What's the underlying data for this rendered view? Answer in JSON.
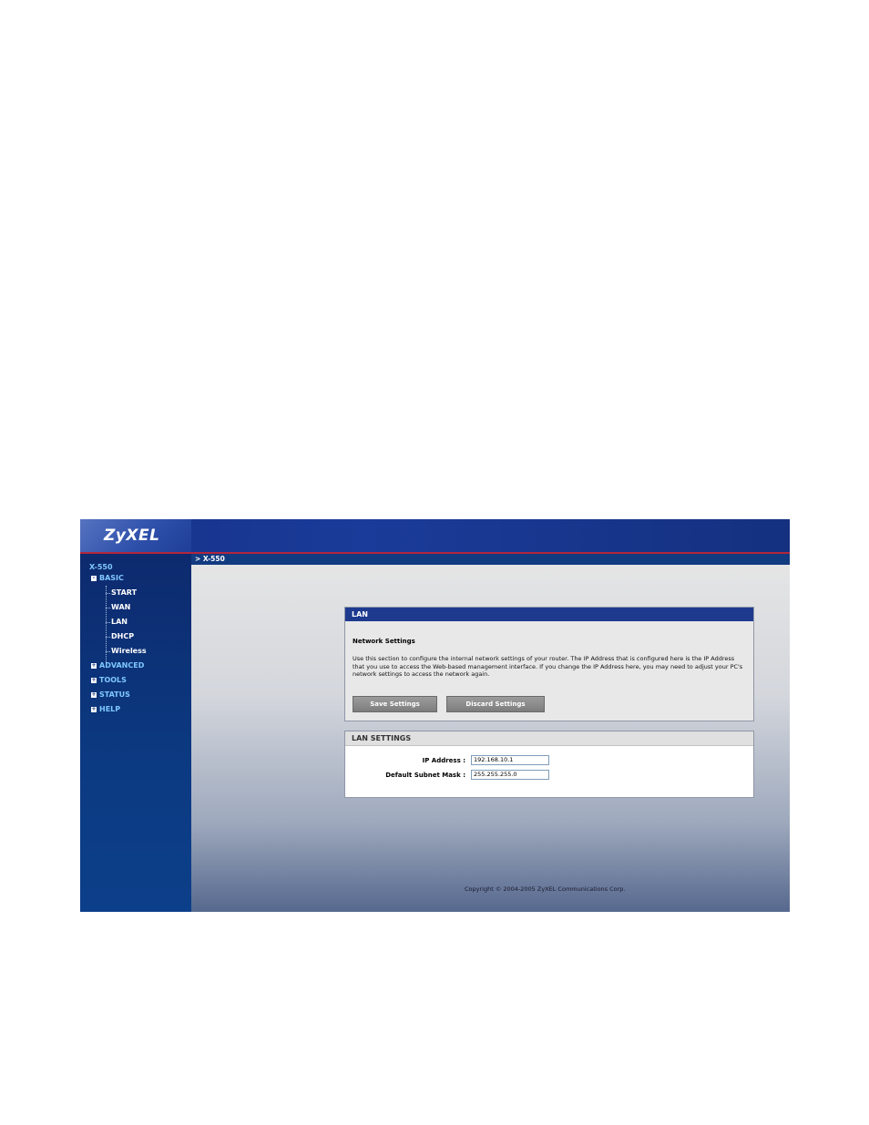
{
  "header": {
    "logo": "ZyXEL"
  },
  "sidebar": {
    "device": "X-550",
    "menu": [
      {
        "label": "BASIC",
        "children": [
          "START",
          "WAN",
          "LAN",
          "DHCP",
          "Wireless"
        ]
      },
      {
        "label": "ADVANCED"
      },
      {
        "label": "TOOLS"
      },
      {
        "label": "STATUS"
      },
      {
        "label": "HELP"
      }
    ]
  },
  "breadcrumb": "> X-550",
  "lan_panel": {
    "title": "LAN",
    "section_title": "Network Settings",
    "description": "Use this section to configure the internal network settings of your router. The IP Address that is configured here is the IP Address that you use to access the Web-based management interface. If you change the IP Address here, you may need to adjust your PC's network settings to access the network again.",
    "save_label": "Save Settings",
    "discard_label": "Discard Settings"
  },
  "lan_settings": {
    "title": "LAN SETTINGS",
    "ip_label": "IP Address :",
    "ip_value": "192.168.10.1",
    "mask_label": "Default Subnet Mask :",
    "mask_value": "255.255.255.0"
  },
  "footer": {
    "copyright": "Copyright © 2004-2005 ZyXEL Communications Corp."
  }
}
